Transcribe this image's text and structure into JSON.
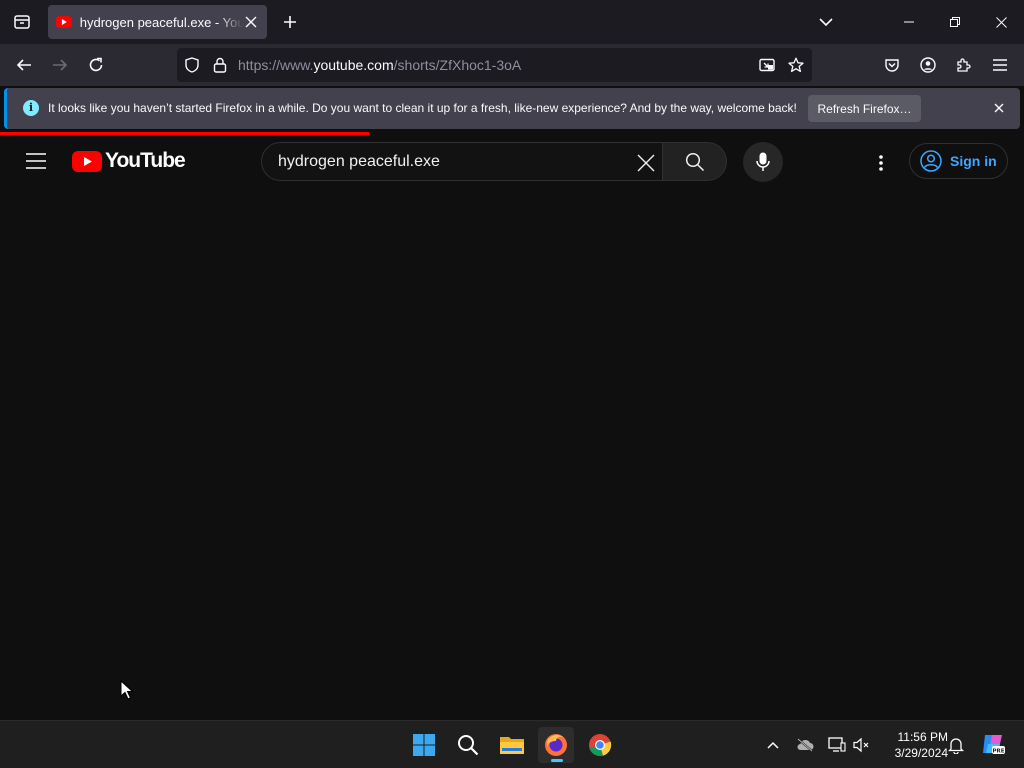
{
  "browser": {
    "tab": {
      "title": "hydrogen peaceful.exe - YouTube"
    },
    "url": {
      "scheme": "https://www.",
      "host": "youtube.com",
      "path": "/shorts/ZfXhoc1-3oA"
    },
    "notification": {
      "message": "It looks like you haven’t started Firefox in a while. Do you want to clean it up for a fresh, like-new experience? And by the way, welcome back!",
      "button_label": "Refresh Firefox…"
    },
    "page_load_progress": 0.36
  },
  "youtube": {
    "logo_text": "YouTube",
    "search": {
      "value": "hydrogen peaceful.exe"
    },
    "sign_in_label": "Sign in"
  },
  "taskbar": {
    "apps": [
      "start-icon",
      "search-icon",
      "file-explorer-icon",
      "firefox-icon",
      "chrome-icon"
    ],
    "active_app": "firefox-icon",
    "clock": {
      "time": "11:56 PM",
      "date": "3/29/2024"
    }
  },
  "colors": {
    "youtube_red": "#ff0000",
    "accent_blue": "#3ea6ff",
    "firefox_info": "#0090ed"
  }
}
